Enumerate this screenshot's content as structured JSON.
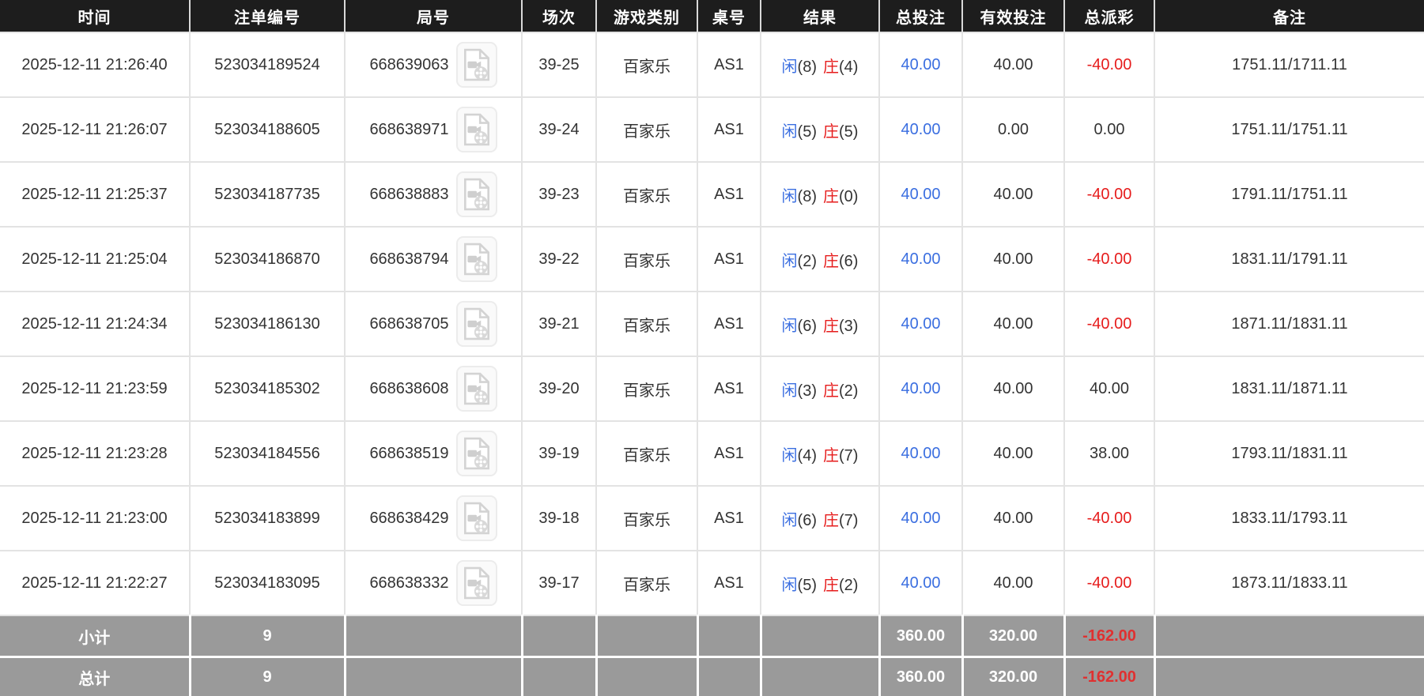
{
  "columns": [
    {
      "key": "time",
      "label": "时间"
    },
    {
      "key": "bet_id",
      "label": "注单编号"
    },
    {
      "key": "round_id",
      "label": "局号"
    },
    {
      "key": "session",
      "label": "场次"
    },
    {
      "key": "game_type",
      "label": "游戏类别"
    },
    {
      "key": "table_no",
      "label": "桌号"
    },
    {
      "key": "result",
      "label": "结果"
    },
    {
      "key": "total_bet",
      "label": "总投注"
    },
    {
      "key": "valid_bet",
      "label": "有效投注"
    },
    {
      "key": "payout",
      "label": "总派彩"
    },
    {
      "key": "remark",
      "label": "备注"
    }
  ],
  "table": {
    "rows": [
      {
        "time": "2025-12-11 21:26:40",
        "bet_id": "523034189524",
        "round_id": "668639063",
        "session": "39-25",
        "game_type": "百家乐",
        "table_no": "AS1",
        "result": {
          "player_label": "闲",
          "player_value": "(8)",
          "banker_label": "庄",
          "banker_value": "(4)"
        },
        "total_bet": "40.00",
        "valid_bet": "40.00",
        "payout": "-40.00",
        "remark": "1751.11/1711.11"
      },
      {
        "time": "2025-12-11 21:26:07",
        "bet_id": "523034188605",
        "round_id": "668638971",
        "session": "39-24",
        "game_type": "百家乐",
        "table_no": "AS1",
        "result": {
          "player_label": "闲",
          "player_value": "(5)",
          "banker_label": "庄",
          "banker_value": "(5)"
        },
        "total_bet": "40.00",
        "valid_bet": "0.00",
        "payout": "0.00",
        "remark": "1751.11/1751.11"
      },
      {
        "time": "2025-12-11 21:25:37",
        "bet_id": "523034187735",
        "round_id": "668638883",
        "session": "39-23",
        "game_type": "百家乐",
        "table_no": "AS1",
        "result": {
          "player_label": "闲",
          "player_value": "(8)",
          "banker_label": "庄",
          "banker_value": "(0)"
        },
        "total_bet": "40.00",
        "valid_bet": "40.00",
        "payout": "-40.00",
        "remark": "1791.11/1751.11"
      },
      {
        "time": "2025-12-11 21:25:04",
        "bet_id": "523034186870",
        "round_id": "668638794",
        "session": "39-22",
        "game_type": "百家乐",
        "table_no": "AS1",
        "result": {
          "player_label": "闲",
          "player_value": "(2)",
          "banker_label": "庄",
          "banker_value": "(6)"
        },
        "total_bet": "40.00",
        "valid_bet": "40.00",
        "payout": "-40.00",
        "remark": "1831.11/1791.11"
      },
      {
        "time": "2025-12-11 21:24:34",
        "bet_id": "523034186130",
        "round_id": "668638705",
        "session": "39-21",
        "game_type": "百家乐",
        "table_no": "AS1",
        "result": {
          "player_label": "闲",
          "player_value": "(6)",
          "banker_label": "庄",
          "banker_value": "(3)"
        },
        "total_bet": "40.00",
        "valid_bet": "40.00",
        "payout": "-40.00",
        "remark": "1871.11/1831.11"
      },
      {
        "time": "2025-12-11 21:23:59",
        "bet_id": "523034185302",
        "round_id": "668638608",
        "session": "39-20",
        "game_type": "百家乐",
        "table_no": "AS1",
        "result": {
          "player_label": "闲",
          "player_value": "(3)",
          "banker_label": "庄",
          "banker_value": "(2)"
        },
        "total_bet": "40.00",
        "valid_bet": "40.00",
        "payout": "40.00",
        "remark": "1831.11/1871.11"
      },
      {
        "time": "2025-12-11 21:23:28",
        "bet_id": "523034184556",
        "round_id": "668638519",
        "session": "39-19",
        "game_type": "百家乐",
        "table_no": "AS1",
        "result": {
          "player_label": "闲",
          "player_value": "(4)",
          "banker_label": "庄",
          "banker_value": "(7)"
        },
        "total_bet": "40.00",
        "valid_bet": "40.00",
        "payout": "38.00",
        "remark": "1793.11/1831.11"
      },
      {
        "time": "2025-12-11 21:23:00",
        "bet_id": "523034183899",
        "round_id": "668638429",
        "session": "39-18",
        "game_type": "百家乐",
        "table_no": "AS1",
        "result": {
          "player_label": "闲",
          "player_value": "(6)",
          "banker_label": "庄",
          "banker_value": "(7)"
        },
        "total_bet": "40.00",
        "valid_bet": "40.00",
        "payout": "-40.00",
        "remark": "1833.11/1793.11"
      },
      {
        "time": "2025-12-11 21:22:27",
        "bet_id": "523034183095",
        "round_id": "668638332",
        "session": "39-17",
        "game_type": "百家乐",
        "table_no": "AS1",
        "result": {
          "player_label": "闲",
          "player_value": "(5)",
          "banker_label": "庄",
          "banker_value": "(2)"
        },
        "total_bet": "40.00",
        "valid_bet": "40.00",
        "payout": "-40.00",
        "remark": "1873.11/1833.11"
      }
    ]
  },
  "summary": {
    "subtotal": {
      "label": "小计",
      "count": "9",
      "total_bet": "360.00",
      "valid_bet": "320.00",
      "payout": "-162.00"
    },
    "total": {
      "label": "总计",
      "count": "9",
      "total_bet": "360.00",
      "valid_bet": "320.00",
      "payout": "-162.00"
    }
  },
  "colors": {
    "header_bg": "#1d1d1d",
    "summary_bg": "#9a9a9a",
    "accent_blue": "#3a6ee0",
    "accent_red": "#e61c1c"
  },
  "icons": {
    "video_record": "video-record-icon"
  }
}
